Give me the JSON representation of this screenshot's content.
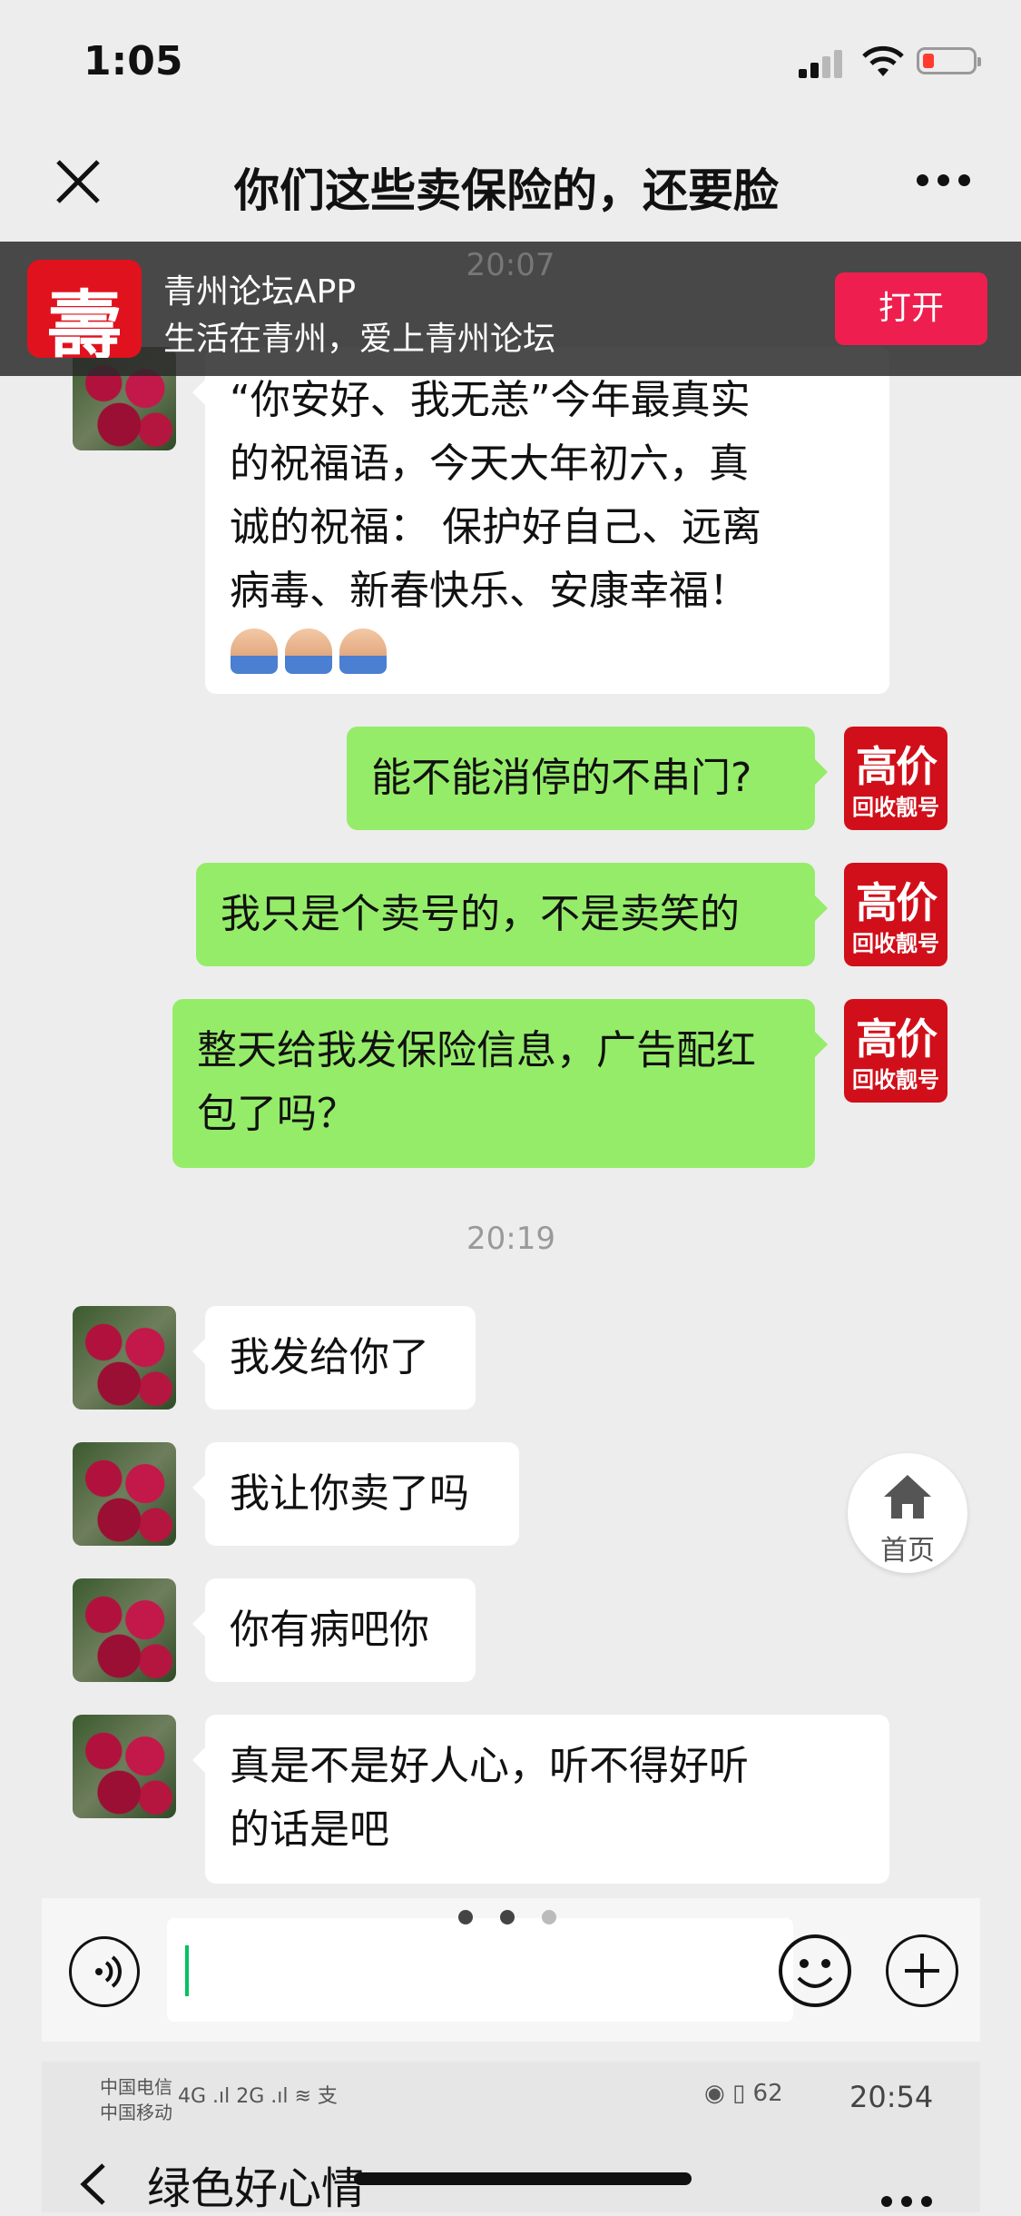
{
  "status_bar": {
    "time": "1:05"
  },
  "nav": {
    "title": "你们这些卖保险的，还要脸"
  },
  "banner": {
    "app_name": "青州论坛APP",
    "slogan": "生活在青州，爱上青州论坛",
    "open_label": "打开",
    "time_behind": "20:07"
  },
  "avatar_ad": {
    "big": "高价",
    "small": "回收靓号"
  },
  "messages": [
    {
      "side": "in",
      "lines": [
        "“你安好、我无恙”今年最真实",
        "的祝福语，今天大年初六，真",
        "诚的祝福： 保护好自己、远离",
        "病毒、新春快乐、安康幸福！"
      ]
    },
    {
      "side": "out",
      "text": "能不能消停的不串门?"
    },
    {
      "side": "out",
      "text": "我只是个卖号的，不是卖笑的"
    },
    {
      "side": "out",
      "lines": [
        "整天给我发保险信息，广告配红",
        "包了吗？"
      ]
    },
    {
      "side": "in",
      "text": "我发给你了"
    },
    {
      "side": "in",
      "text": "我让你卖了吗"
    },
    {
      "side": "in",
      "text": "你有病吧你"
    },
    {
      "side": "in",
      "lines": [
        "真是不是好人心，听不得好听",
        "的话是吧"
      ]
    }
  ],
  "timestamp_2": "20:19",
  "home_fab": {
    "label": "首页"
  },
  "input": {
    "value": ""
  },
  "bottom_status": {
    "carrier1": "中国电信",
    "carrier2": "中国移动",
    "net": "4G .ıl  2G .ıl  ≋ 支",
    "right_icons": "◉ ▯ 62",
    "time": "20:54",
    "title": "绿色好心情"
  },
  "colors": {
    "outgoing": "#95ec69",
    "open_button": "#ee1f4f",
    "caret": "#07c160"
  }
}
